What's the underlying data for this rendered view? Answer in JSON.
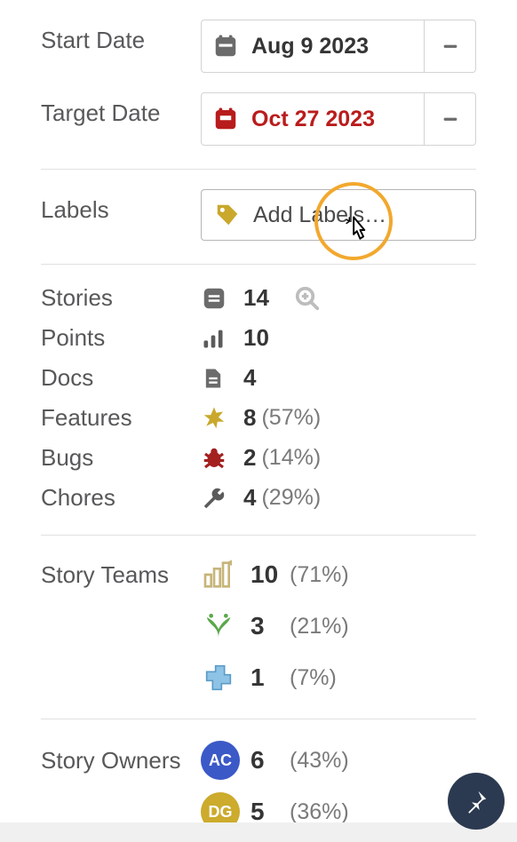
{
  "dates": {
    "start_label": "Start Date",
    "start_value": "Aug 9 2023",
    "target_label": "Target Date",
    "target_value": "Oct 27 2023"
  },
  "labels_section": {
    "label": "Labels",
    "add_text": "Add Labels…"
  },
  "stats": {
    "stories": {
      "label": "Stories",
      "value": "14"
    },
    "points": {
      "label": "Points",
      "value": "10"
    },
    "docs": {
      "label": "Docs",
      "value": "4"
    },
    "features": {
      "label": "Features",
      "value": "8",
      "pct": "(57%)"
    },
    "bugs": {
      "label": "Bugs",
      "value": "2",
      "pct": "(14%)"
    },
    "chores": {
      "label": "Chores",
      "value": "4",
      "pct": "(29%)"
    }
  },
  "teams": {
    "label": "Story Teams",
    "items": [
      {
        "value": "10",
        "pct": "(71%)"
      },
      {
        "value": "3",
        "pct": "(21%)"
      },
      {
        "value": "1",
        "pct": "(7%)"
      }
    ]
  },
  "owners": {
    "label": "Story Owners",
    "items": [
      {
        "initials": "AC",
        "value": "6",
        "pct": "(43%)"
      },
      {
        "initials": "DG",
        "value": "5",
        "pct": "(36%)"
      }
    ]
  }
}
